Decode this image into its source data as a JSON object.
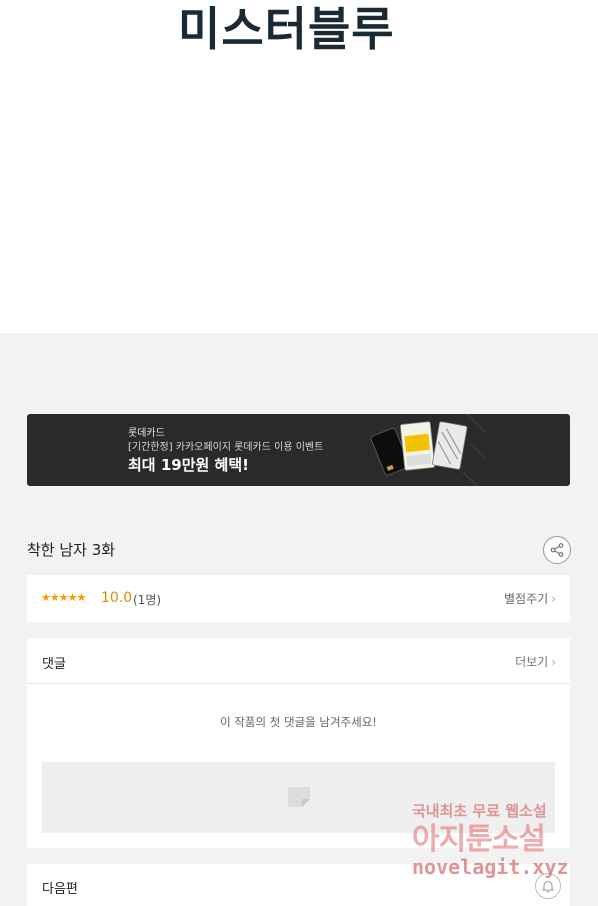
{
  "header": {
    "series_title": "미스터블루"
  },
  "banner": {
    "brand": "롯데카드",
    "subtitle": "[기간한정] 카카오페이지 롯데카드 이용 이벤트",
    "headline": "최대 19만원 혜택!"
  },
  "episode": {
    "title": "착한 남자 3화",
    "share_icon": "share-icon"
  },
  "rating": {
    "stars": "★★★★★",
    "score": "10.0",
    "count": "(1명)",
    "rate_label": "별점주기",
    "chevron": "›"
  },
  "comments": {
    "label": "댓글",
    "more_label": "더보기",
    "chevron": "›",
    "empty_message": "이 작품의 첫 댓글을 남겨주세요!"
  },
  "next": {
    "label": "다음편",
    "bell_icon": "bell-icon"
  },
  "watermark": {
    "line1": "국내최초 무료 웹소설",
    "line2": "아지툰소설",
    "line3": "novelagit.xyz"
  },
  "colors": {
    "accent_star": "#f59b00",
    "banner_bg": "#2a2a2a",
    "page_bg": "#f2f2f2"
  }
}
